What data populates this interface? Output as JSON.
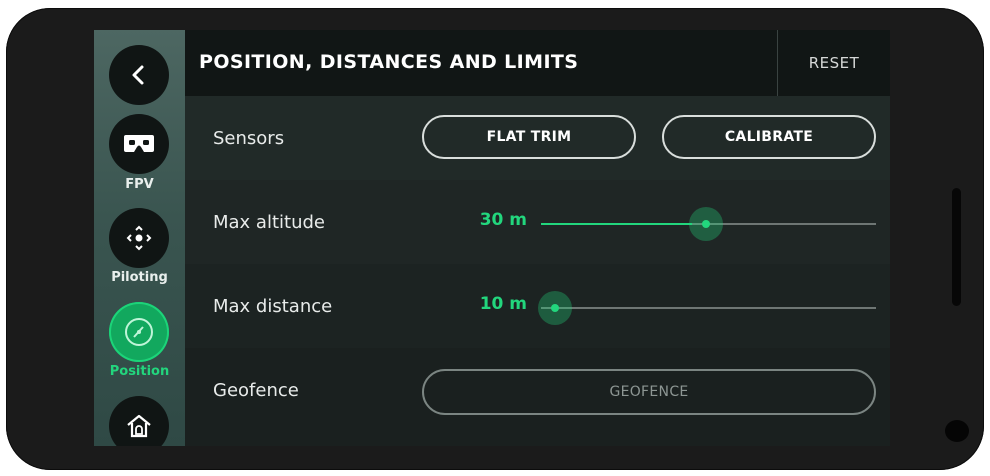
{
  "header": {
    "title": "POSITION, DISTANCES AND LIMITS",
    "reset_label": "RESET"
  },
  "sidebar": {
    "items": [
      {
        "icon": "back-arrow-icon",
        "label": ""
      },
      {
        "icon": "vr-headset-icon",
        "label": "FPV"
      },
      {
        "icon": "piloting-icon",
        "label": "Piloting"
      },
      {
        "icon": "compass-icon",
        "label": "Position",
        "active": true
      },
      {
        "icon": "home-icon",
        "label": ""
      }
    ]
  },
  "settings": {
    "sensors": {
      "label": "Sensors",
      "flat_trim_label": "FLAT TRIM",
      "calibrate_label": "CALIBRATE"
    },
    "max_altitude": {
      "label": "Max altitude",
      "value_text": "30 m",
      "fraction": 0.45
    },
    "max_distance": {
      "label": "Max distance",
      "value_text": "10 m",
      "fraction": 0.0
    },
    "geofence": {
      "label": "Geofence",
      "button_label": "GEOFENCE",
      "enabled": false
    }
  },
  "colors": {
    "accent": "#22d67d",
    "active_button": "#12a85e",
    "background": "#1c2321"
  }
}
